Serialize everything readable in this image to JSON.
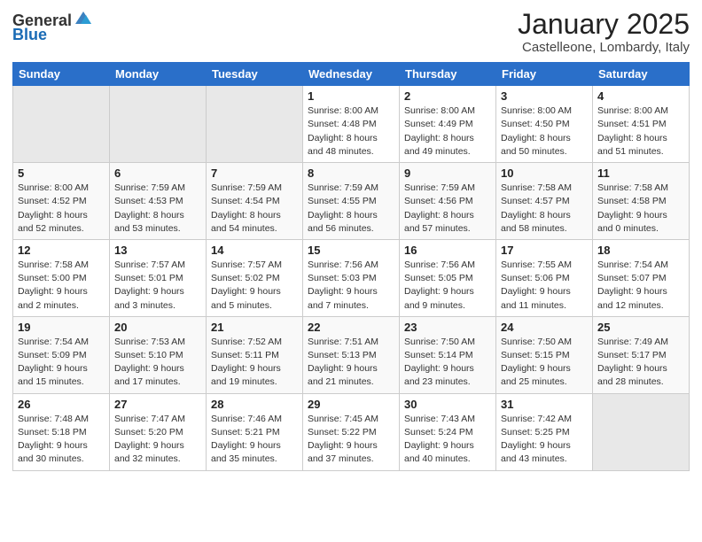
{
  "header": {
    "logo_general": "General",
    "logo_blue": "Blue",
    "month_title": "January 2025",
    "location": "Castelleone, Lombardy, Italy"
  },
  "weekdays": [
    "Sunday",
    "Monday",
    "Tuesday",
    "Wednesday",
    "Thursday",
    "Friday",
    "Saturday"
  ],
  "weeks": [
    [
      {
        "day": "",
        "info": ""
      },
      {
        "day": "",
        "info": ""
      },
      {
        "day": "",
        "info": ""
      },
      {
        "day": "1",
        "info": "Sunrise: 8:00 AM\nSunset: 4:48 PM\nDaylight: 8 hours\nand 48 minutes."
      },
      {
        "day": "2",
        "info": "Sunrise: 8:00 AM\nSunset: 4:49 PM\nDaylight: 8 hours\nand 49 minutes."
      },
      {
        "day": "3",
        "info": "Sunrise: 8:00 AM\nSunset: 4:50 PM\nDaylight: 8 hours\nand 50 minutes."
      },
      {
        "day": "4",
        "info": "Sunrise: 8:00 AM\nSunset: 4:51 PM\nDaylight: 8 hours\nand 51 minutes."
      }
    ],
    [
      {
        "day": "5",
        "info": "Sunrise: 8:00 AM\nSunset: 4:52 PM\nDaylight: 8 hours\nand 52 minutes."
      },
      {
        "day": "6",
        "info": "Sunrise: 7:59 AM\nSunset: 4:53 PM\nDaylight: 8 hours\nand 53 minutes."
      },
      {
        "day": "7",
        "info": "Sunrise: 7:59 AM\nSunset: 4:54 PM\nDaylight: 8 hours\nand 54 minutes."
      },
      {
        "day": "8",
        "info": "Sunrise: 7:59 AM\nSunset: 4:55 PM\nDaylight: 8 hours\nand 56 minutes."
      },
      {
        "day": "9",
        "info": "Sunrise: 7:59 AM\nSunset: 4:56 PM\nDaylight: 8 hours\nand 57 minutes."
      },
      {
        "day": "10",
        "info": "Sunrise: 7:58 AM\nSunset: 4:57 PM\nDaylight: 8 hours\nand 58 minutes."
      },
      {
        "day": "11",
        "info": "Sunrise: 7:58 AM\nSunset: 4:58 PM\nDaylight: 9 hours\nand 0 minutes."
      }
    ],
    [
      {
        "day": "12",
        "info": "Sunrise: 7:58 AM\nSunset: 5:00 PM\nDaylight: 9 hours\nand 2 minutes."
      },
      {
        "day": "13",
        "info": "Sunrise: 7:57 AM\nSunset: 5:01 PM\nDaylight: 9 hours\nand 3 minutes."
      },
      {
        "day": "14",
        "info": "Sunrise: 7:57 AM\nSunset: 5:02 PM\nDaylight: 9 hours\nand 5 minutes."
      },
      {
        "day": "15",
        "info": "Sunrise: 7:56 AM\nSunset: 5:03 PM\nDaylight: 9 hours\nand 7 minutes."
      },
      {
        "day": "16",
        "info": "Sunrise: 7:56 AM\nSunset: 5:05 PM\nDaylight: 9 hours\nand 9 minutes."
      },
      {
        "day": "17",
        "info": "Sunrise: 7:55 AM\nSunset: 5:06 PM\nDaylight: 9 hours\nand 11 minutes."
      },
      {
        "day": "18",
        "info": "Sunrise: 7:54 AM\nSunset: 5:07 PM\nDaylight: 9 hours\nand 12 minutes."
      }
    ],
    [
      {
        "day": "19",
        "info": "Sunrise: 7:54 AM\nSunset: 5:09 PM\nDaylight: 9 hours\nand 15 minutes."
      },
      {
        "day": "20",
        "info": "Sunrise: 7:53 AM\nSunset: 5:10 PM\nDaylight: 9 hours\nand 17 minutes."
      },
      {
        "day": "21",
        "info": "Sunrise: 7:52 AM\nSunset: 5:11 PM\nDaylight: 9 hours\nand 19 minutes."
      },
      {
        "day": "22",
        "info": "Sunrise: 7:51 AM\nSunset: 5:13 PM\nDaylight: 9 hours\nand 21 minutes."
      },
      {
        "day": "23",
        "info": "Sunrise: 7:50 AM\nSunset: 5:14 PM\nDaylight: 9 hours\nand 23 minutes."
      },
      {
        "day": "24",
        "info": "Sunrise: 7:50 AM\nSunset: 5:15 PM\nDaylight: 9 hours\nand 25 minutes."
      },
      {
        "day": "25",
        "info": "Sunrise: 7:49 AM\nSunset: 5:17 PM\nDaylight: 9 hours\nand 28 minutes."
      }
    ],
    [
      {
        "day": "26",
        "info": "Sunrise: 7:48 AM\nSunset: 5:18 PM\nDaylight: 9 hours\nand 30 minutes."
      },
      {
        "day": "27",
        "info": "Sunrise: 7:47 AM\nSunset: 5:20 PM\nDaylight: 9 hours\nand 32 minutes."
      },
      {
        "day": "28",
        "info": "Sunrise: 7:46 AM\nSunset: 5:21 PM\nDaylight: 9 hours\nand 35 minutes."
      },
      {
        "day": "29",
        "info": "Sunrise: 7:45 AM\nSunset: 5:22 PM\nDaylight: 9 hours\nand 37 minutes."
      },
      {
        "day": "30",
        "info": "Sunrise: 7:43 AM\nSunset: 5:24 PM\nDaylight: 9 hours\nand 40 minutes."
      },
      {
        "day": "31",
        "info": "Sunrise: 7:42 AM\nSunset: 5:25 PM\nDaylight: 9 hours\nand 43 minutes."
      },
      {
        "day": "",
        "info": ""
      }
    ]
  ],
  "row_classes": [
    "row-week1",
    "row-week2",
    "row-week3",
    "row-week4",
    "row-week5"
  ]
}
